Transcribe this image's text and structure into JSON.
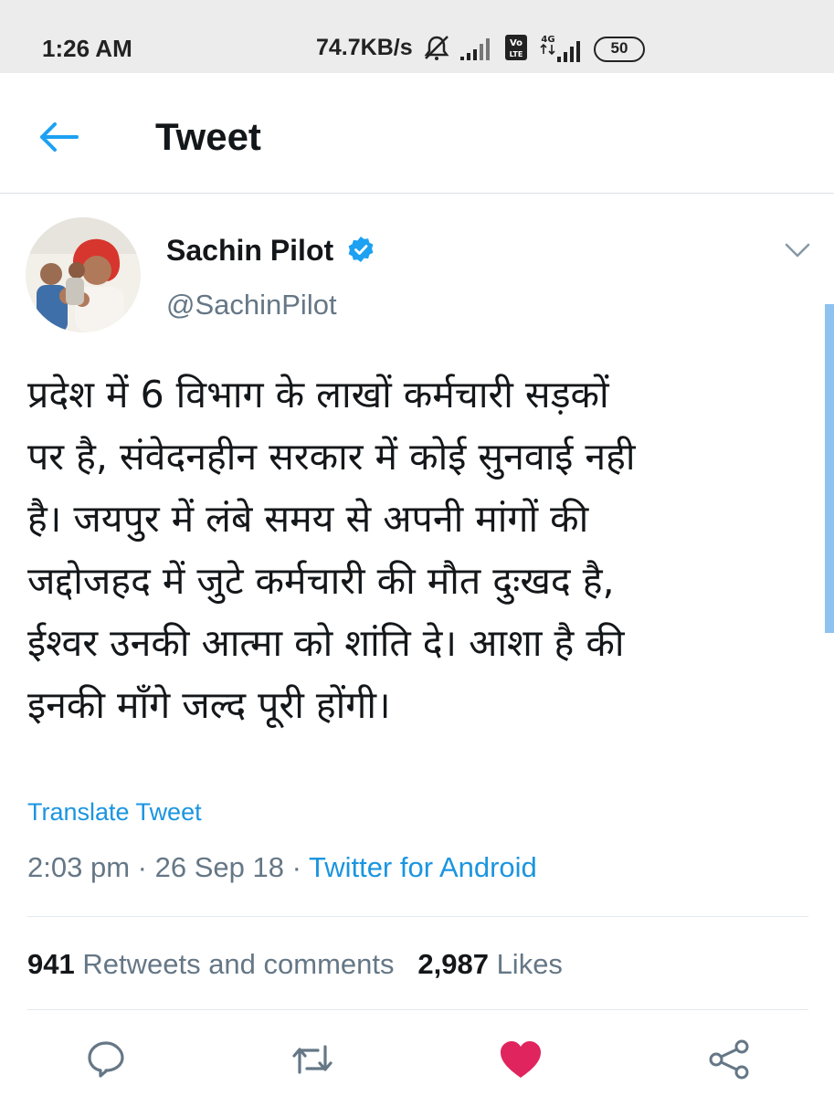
{
  "status_bar": {
    "time": "1:26 AM",
    "network_speed": "74.7KB/s",
    "battery_level": "50",
    "icons": [
      "mute-icon",
      "signal-icon",
      "volte-icon",
      "4g-signal-icon",
      "battery-icon"
    ]
  },
  "header": {
    "title": "Tweet",
    "back_icon": "arrow-left-icon"
  },
  "author": {
    "name": "Sachin Pilot",
    "handle": "@SachinPilot",
    "verified": true
  },
  "tweet": {
    "lines": [
      "प्रदेश में 6 विभाग के लाखों कर्मचारी सड़कों",
      "पर है, संवेदनहीन सरकार में कोई सुनवाई नही",
      "है। जयपुर में लंबे समय से अपनी मांगों की",
      "जद्दोजहद में जुटे कर्मचारी की मौत दुःखद है,",
      "ईश्वर उनकी आत्मा को शांति दे। आशा है की",
      "इनकी माँगे जल्द पूरी होंगी।"
    ],
    "translate_label": "Translate Tweet",
    "time": "2:03 pm",
    "separator": "·",
    "date": "26 Sep 18",
    "source": "Twitter for Android"
  },
  "stats": {
    "retweets_count": "941",
    "retweets_label": "Retweets and comments",
    "likes_count": "2,987",
    "likes_label": "Likes"
  },
  "actions": [
    "reply-icon",
    "retweet-icon",
    "like-icon",
    "share-icon"
  ],
  "colors": {
    "accent": "#1b95e0",
    "like": "#e0245e",
    "secondary_text": "#657786",
    "status_bar_bg": "#ececec"
  }
}
